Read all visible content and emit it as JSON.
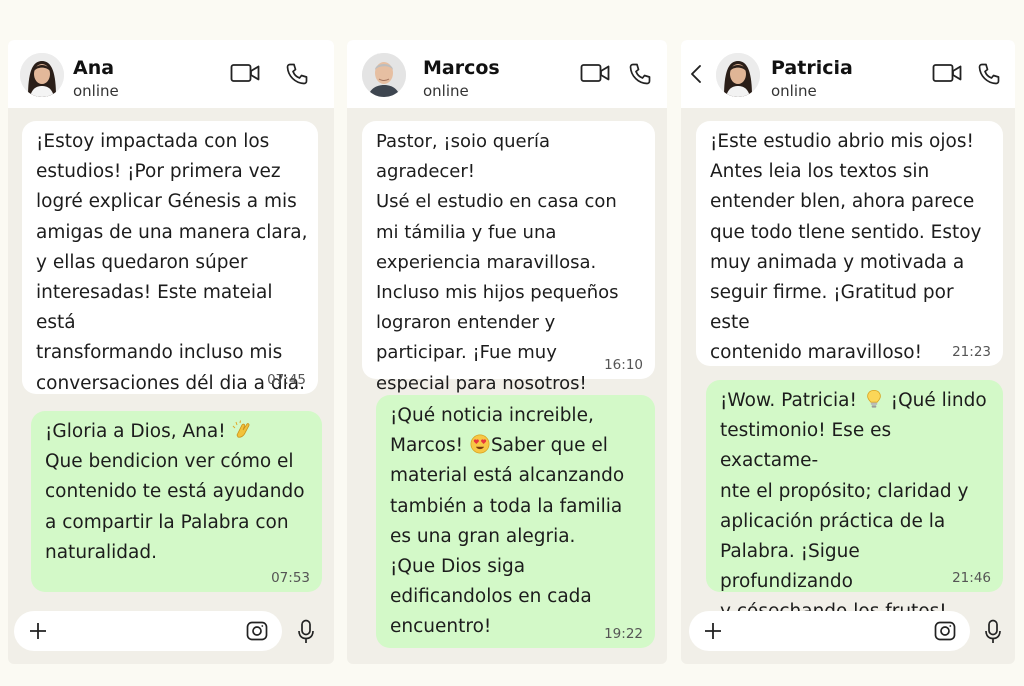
{
  "chats": [
    {
      "contact": {
        "name": "Ana",
        "status": "online"
      },
      "messages": [
        {
          "dir": "in",
          "text": "¡Estoy impactada con los\nestudios! ¡Por primera vez\nlogré explicar Génesis a mis\namigas de una manera clara,\ny ellas quedaron súper\ninteresadas! Este mateial está\ntransformando incluso mis\nconversaciones dél dia a dia.",
          "time": "07:45"
        },
        {
          "dir": "out",
          "text_lines": [
            "¡Gloria a Dios, Ana!",
            "Que bendicion ver cómo el\ncontenido te está ayudando\na compartir la Palabra con\nnaturalidad."
          ],
          "emoji": "clapping-hands",
          "time": "07:53"
        }
      ],
      "composer": {
        "placeholder": ""
      }
    },
    {
      "contact": {
        "name": "Marcos",
        "status": "online"
      },
      "messages": [
        {
          "dir": "in",
          "text": "Pastor, ¡soio quería agradecer!\nUsé el estudio en casa con\nmi támilia y fue una\nexperiencia maravillosa.\nIncluso mis hijos pequeños\nlograron entender y\nparticipar. ¡Fue muy\nespecial para nosotros!",
          "time": "16:10"
        },
        {
          "dir": "out",
          "text_lines": [
            "¡Qué noticia increible,\nMarcos!",
            "Saber que el\nmaterial está alcanzando\ntambién a toda la familia\nes una gran alegria.\n¡Que Dios siga\nedificandolos en cada\nencuentro!"
          ],
          "emoji": "heart-eyes",
          "time": "19:22"
        }
      ]
    },
    {
      "contact": {
        "name": "Patricia",
        "status": "online"
      },
      "messages": [
        {
          "dir": "in",
          "text": "¡Este estudio abrio mis ojos!\nAntes leia los textos sin\nentender blen, ahora parece\nque todo tlene sentido. Estoy\nmuy animada y motivada a\nseguir firme. ¡Gratitud por este\ncontenido maravilloso!",
          "time": "21:23"
        },
        {
          "dir": "out",
          "text_lines": [
            "¡Wow. Patricia!",
            "¡Qué lindo\ntestimonio! Ese es exactame-\nnte el propósito; claridad y\naplicación práctica de la\nPalabra. ¡Sigue profundizando\ny cósechando los frutos!"
          ],
          "emoji": "light-bulb",
          "time": "21:46"
        }
      ],
      "composer": {
        "placeholder": ""
      }
    }
  ],
  "icons": {
    "header": [
      "video-camera-icon",
      "phone-icon",
      "back-chevron-icon"
    ],
    "composer": [
      "plus-icon",
      "camera-icon",
      "microphone-icon"
    ]
  },
  "colors": {
    "outgoing_bubble": "#d3f9c8",
    "incoming_bubble": "#ffffff",
    "chat_background": "#f1efe8",
    "page_background": "#fbfaf3"
  }
}
